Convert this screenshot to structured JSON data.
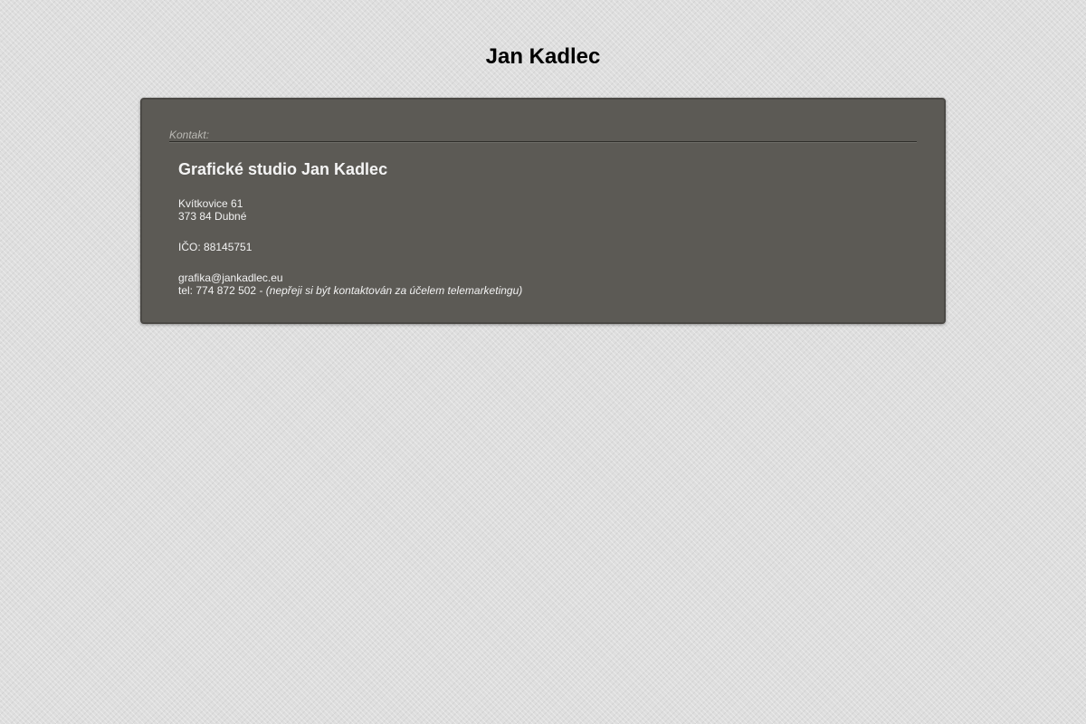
{
  "header": {
    "title": "Jan Kadlec"
  },
  "contact_section": {
    "label": "Kontakt:",
    "company": "Grafické studio Jan Kadlec",
    "address": {
      "street": "Kvítkovice 61",
      "city": "373 84 Dubné"
    },
    "ico_label": "IČO:",
    "ico_value": "88145751",
    "email": "grafika@jankadlec.eu",
    "phone_label": "tel:",
    "phone_number": "774 872 502",
    "phone_separator": "-",
    "phone_note": "(nepřeji si být kontaktován za účelem telemarketingu)"
  },
  "colors": {
    "page_background": "#dedede",
    "panel_background": "#5c5a55",
    "panel_text": "#f2f2f2",
    "label_text": "#b9b8b3"
  }
}
